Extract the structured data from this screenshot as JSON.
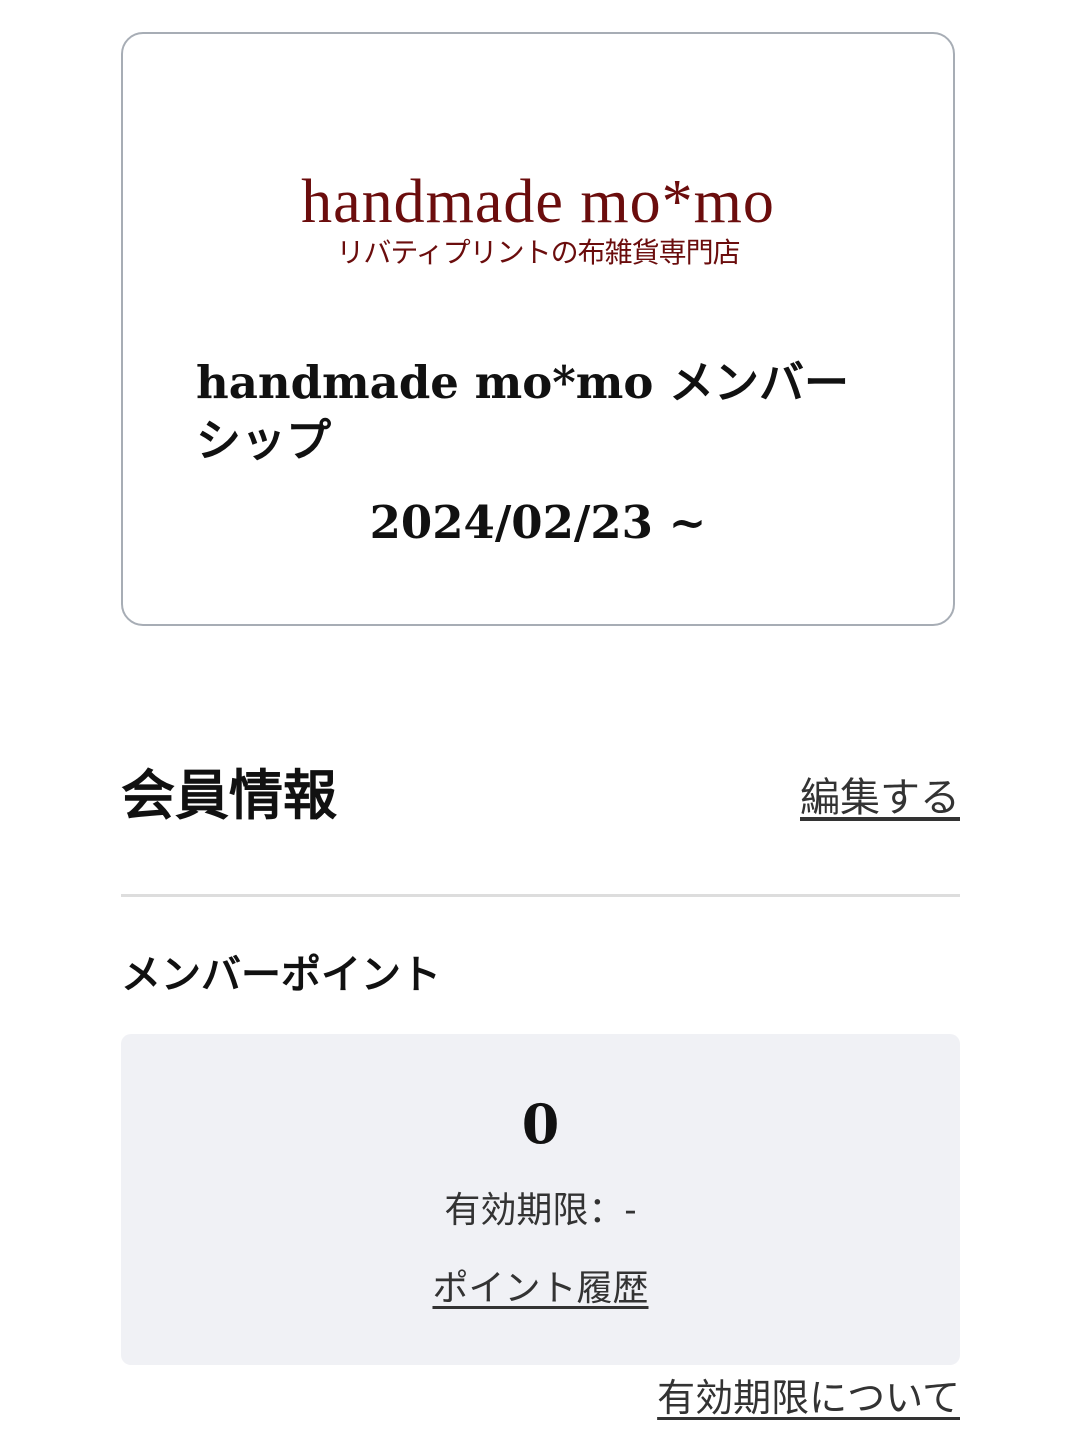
{
  "card": {
    "logo_main": "handmade mo*mo",
    "logo_sub": "リバティプリントの布雑貨専門店",
    "title": "handmade mo*mo メンバーシップ",
    "date": "2024/02/23 ~"
  },
  "member_info": {
    "title": "会員情報",
    "edit_label": "編集する"
  },
  "points": {
    "label": "メンバーポイント",
    "value": "0",
    "expiry_text": "有効期限：-",
    "history_label": "ポイント履歴",
    "about_expiry_label": "有効期限について"
  },
  "colors": {
    "logo": "#6b0d0d",
    "card_border": "#a7adb5",
    "points_bg": "#f0f1f5",
    "divider": "#dddddd"
  }
}
